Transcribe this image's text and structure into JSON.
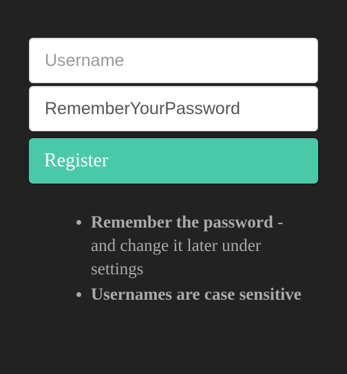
{
  "form": {
    "username_placeholder": "Username",
    "password_value": "RememberYourPassword",
    "register_label": "Register"
  },
  "info": {
    "item1_bold": "Remember the password",
    "item1_rest": " - and change it later under settings",
    "item2_bold": "Usernames are case sensitive"
  }
}
